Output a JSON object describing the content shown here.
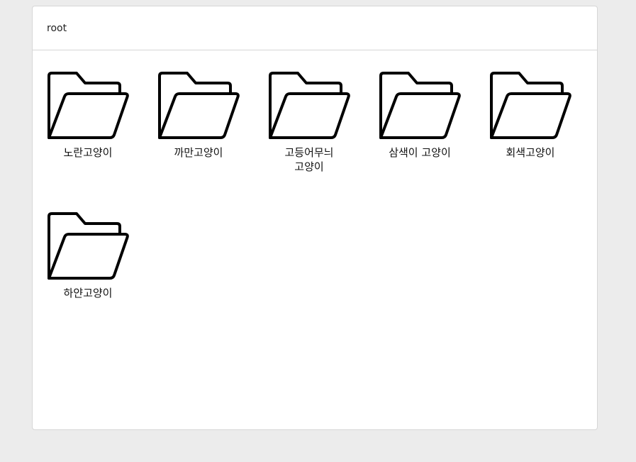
{
  "breadcrumb": {
    "path": "root"
  },
  "folders": [
    {
      "name": "노란고양이",
      "icon": "folder-icon"
    },
    {
      "name": "까만고양이",
      "icon": "folder-icon"
    },
    {
      "name": "고등어무늬 고양이",
      "icon": "folder-icon"
    },
    {
      "name": "삼색이 고양이",
      "icon": "folder-icon"
    },
    {
      "name": "회색고양이",
      "icon": "folder-icon"
    },
    {
      "name": "하얀고양이",
      "icon": "folder-icon"
    }
  ],
  "colors": {
    "background": "#ececec",
    "panel": "#ffffff",
    "border": "#d6d6d6",
    "icon_stroke": "#000000"
  }
}
